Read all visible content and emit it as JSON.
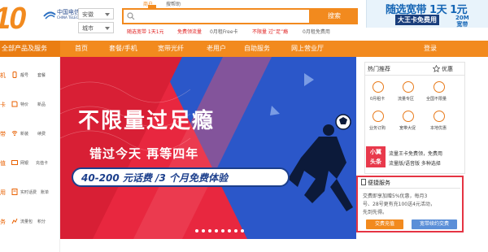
{
  "header": {
    "logo_text": "10",
    "brand_cn": "中国电信",
    "brand_en": "CHINA TELECOM",
    "province": "安徽",
    "city": "城市",
    "search_tabs": [
      "商户",
      "搜帮助"
    ],
    "search_placeholder": "",
    "search_button": "搜索",
    "hot_words": [
      {
        "text": "随选宽带 1天1元",
        "red": true
      },
      {
        "text": "免费领流量",
        "red": true
      },
      {
        "text": "0月租Free卡",
        "red": false
      },
      {
        "text": "不限量 过“足”瘾",
        "red": true
      },
      {
        "text": "0月租免费用",
        "red": false
      }
    ],
    "promo_main": "随选宽带 1天 1元",
    "promo_sub": "大王卡免费用",
    "promo_badge": [
      "20M",
      "宽带"
    ]
  },
  "nav": {
    "all_label": "全部产品及服务",
    "items": [
      "首页",
      "套餐/手机",
      "宽带光纤",
      "老用户",
      "自助服务",
      "网上营业厅"
    ],
    "login": "登录"
  },
  "categories": [
    {
      "head": "机",
      "links": [
        "靓号",
        "套餐"
      ]
    },
    {
      "head": "卡",
      "links": [
        "特价",
        "新品"
      ]
    },
    {
      "head": "带",
      "links": [
        "新装",
        "续费"
      ]
    },
    {
      "head": "值",
      "links": [
        "网银",
        "充值卡"
      ]
    },
    {
      "head": "用",
      "links": [
        "实时话费",
        "账单"
      ]
    },
    {
      "head": "务",
      "links": [
        "流量包",
        "积分"
      ]
    }
  ],
  "banner": {
    "title": "不限量过足瘾",
    "subtitle": "错过今天  再等四年",
    "pill_text": "40-200 元话费 /3 个月免费体验",
    "dot_count": 8,
    "active_dot": 0
  },
  "sidebar": {
    "tab_hot": "热门推荐",
    "tab_deals": "优惠",
    "shortcuts": [
      {
        "label": "0月租卡",
        "icon": "sim-card-icon"
      },
      {
        "label": "流量专区",
        "icon": "data-traffic-icon"
      },
      {
        "label": "全国不限量",
        "icon": "unlimited-icon"
      },
      {
        "label": "业务订购",
        "icon": "order-icon"
      },
      {
        "label": "宽带大促",
        "icon": "broadband-icon"
      },
      {
        "label": "本地优惠",
        "icon": "local-offers-icon"
      }
    ],
    "news_badge": [
      "小翼",
      "头条"
    ],
    "news_lines": [
      "流量王卡免费领，免费用",
      "流量版/语音版 多种选择"
    ],
    "service_title": "便捷服务",
    "service_lines": [
      "交费即享加赠5%优惠，每月3",
      "号、28号更有充100送4元活动，",
      "先到先得。"
    ],
    "btn_pay": "交费充值",
    "btn_broadband": "宽带续约交费"
  },
  "colors": {
    "orange": "#f28a1e",
    "red": "#e8273f",
    "blue": "#1c3f8c"
  }
}
